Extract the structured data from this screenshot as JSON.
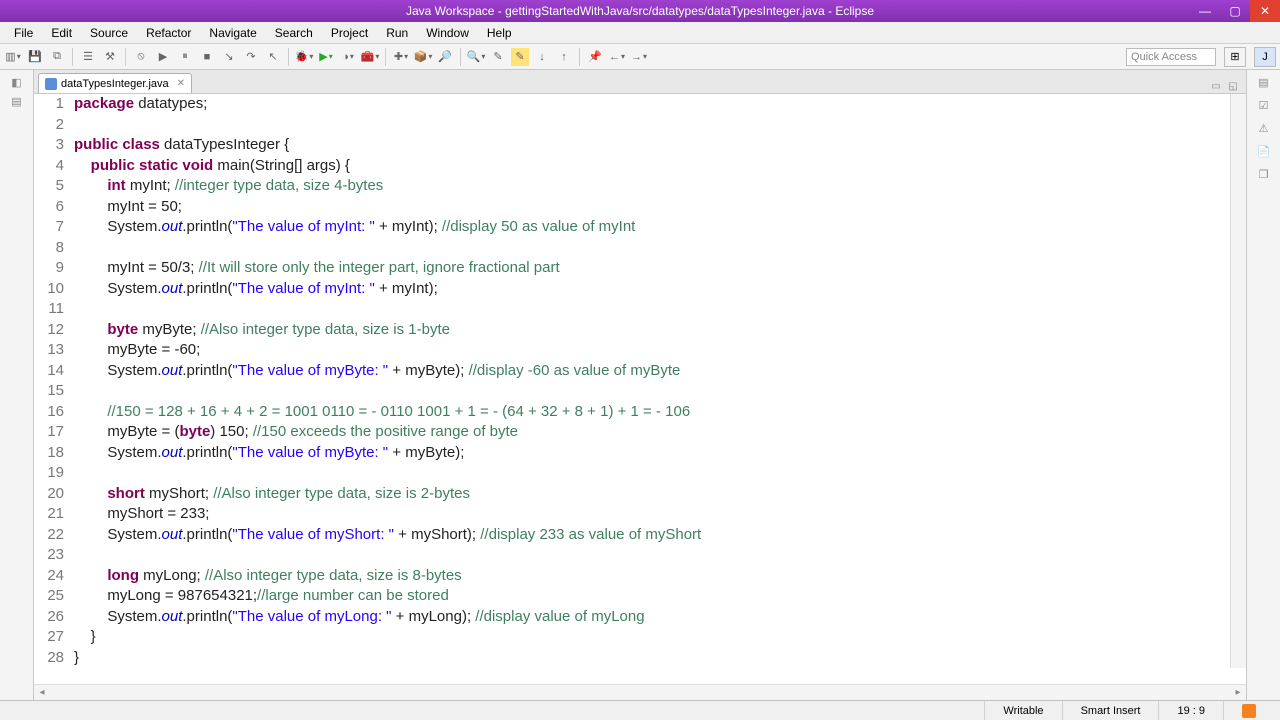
{
  "window": {
    "title": "Java Workspace - gettingStartedWithJava/src/datatypes/dataTypesInteger.java - Eclipse"
  },
  "menus": [
    "File",
    "Edit",
    "Source",
    "Refactor",
    "Navigate",
    "Search",
    "Project",
    "Run",
    "Window",
    "Help"
  ],
  "quick_access": "Quick Access",
  "tab": {
    "name": "dataTypesInteger.java"
  },
  "status": {
    "writable": "Writable",
    "insert": "Smart Insert",
    "position": "19 : 9"
  },
  "code": {
    "lines": [
      {
        "n": 1,
        "tokens": [
          {
            "t": "kw",
            "v": "package"
          },
          {
            "t": "p",
            "v": " datatypes;"
          }
        ]
      },
      {
        "n": 2,
        "tokens": []
      },
      {
        "n": 3,
        "tokens": [
          {
            "t": "kw",
            "v": "public"
          },
          {
            "t": "p",
            "v": " "
          },
          {
            "t": "kw",
            "v": "class"
          },
          {
            "t": "p",
            "v": " dataTypesInteger {"
          }
        ]
      },
      {
        "n": 4,
        "tokens": [
          {
            "t": "p",
            "v": "    "
          },
          {
            "t": "kw",
            "v": "public"
          },
          {
            "t": "p",
            "v": " "
          },
          {
            "t": "kw",
            "v": "static"
          },
          {
            "t": "p",
            "v": " "
          },
          {
            "t": "kw",
            "v": "void"
          },
          {
            "t": "p",
            "v": " main(String[] args) {"
          }
        ]
      },
      {
        "n": 5,
        "tokens": [
          {
            "t": "p",
            "v": "        "
          },
          {
            "t": "kw",
            "v": "int"
          },
          {
            "t": "p",
            "v": " myInt; "
          },
          {
            "t": "cmt",
            "v": "//integer type data, size 4-bytes"
          }
        ]
      },
      {
        "n": 6,
        "tokens": [
          {
            "t": "p",
            "v": "        myInt = 50;"
          }
        ]
      },
      {
        "n": 7,
        "tokens": [
          {
            "t": "p",
            "v": "        System."
          },
          {
            "t": "fld",
            "v": "out"
          },
          {
            "t": "p",
            "v": ".println("
          },
          {
            "t": "str",
            "v": "\"The value of myInt: \""
          },
          {
            "t": "p",
            "v": " + myInt); "
          },
          {
            "t": "cmt",
            "v": "//display 50 as value of myInt"
          }
        ]
      },
      {
        "n": 8,
        "tokens": []
      },
      {
        "n": 9,
        "tokens": [
          {
            "t": "p",
            "v": "        myInt = 50/3; "
          },
          {
            "t": "cmt",
            "v": "//It will store only the integer part, ignore fractional part"
          }
        ]
      },
      {
        "n": 10,
        "tokens": [
          {
            "t": "p",
            "v": "        System."
          },
          {
            "t": "fld",
            "v": "out"
          },
          {
            "t": "p",
            "v": ".println("
          },
          {
            "t": "str",
            "v": "\"The value of myInt: \""
          },
          {
            "t": "p",
            "v": " + myInt);"
          }
        ]
      },
      {
        "n": 11,
        "tokens": []
      },
      {
        "n": 12,
        "tokens": [
          {
            "t": "p",
            "v": "        "
          },
          {
            "t": "kw",
            "v": "byte"
          },
          {
            "t": "p",
            "v": " myByte; "
          },
          {
            "t": "cmt",
            "v": "//Also integer type data, size is 1-byte"
          }
        ]
      },
      {
        "n": 13,
        "tokens": [
          {
            "t": "p",
            "v": "        myByte = -60;"
          }
        ]
      },
      {
        "n": 14,
        "tokens": [
          {
            "t": "p",
            "v": "        System."
          },
          {
            "t": "fld",
            "v": "out"
          },
          {
            "t": "p",
            "v": ".println("
          },
          {
            "t": "str",
            "v": "\"The value of myByte: \""
          },
          {
            "t": "p",
            "v": " + myByte); "
          },
          {
            "t": "cmt",
            "v": "//display -60 as value of myByte"
          }
        ]
      },
      {
        "n": 15,
        "tokens": []
      },
      {
        "n": 16,
        "tokens": [
          {
            "t": "p",
            "v": "        "
          },
          {
            "t": "cmt",
            "v": "//150 = 128 + 16 + 4 + 2 = 1001 0110 = - 0110 1001 + 1 = - (64 + 32 + 8 + 1) + 1 = - 106"
          }
        ]
      },
      {
        "n": 17,
        "tokens": [
          {
            "t": "p",
            "v": "        myByte = ("
          },
          {
            "t": "kw",
            "v": "byte"
          },
          {
            "t": "p",
            "v": ") 150; "
          },
          {
            "t": "cmt",
            "v": "//150 exceeds the positive range of byte"
          }
        ]
      },
      {
        "n": 18,
        "tokens": [
          {
            "t": "p",
            "v": "        System."
          },
          {
            "t": "fld",
            "v": "out"
          },
          {
            "t": "p",
            "v": ".println("
          },
          {
            "t": "str",
            "v": "\"The value of myByte: \""
          },
          {
            "t": "p",
            "v": " + myByte);"
          }
        ]
      },
      {
        "n": 19,
        "tokens": [
          {
            "t": "p",
            "v": "        "
          }
        ],
        "highlight": true
      },
      {
        "n": 20,
        "tokens": [
          {
            "t": "p",
            "v": "        "
          },
          {
            "t": "kw",
            "v": "short"
          },
          {
            "t": "p",
            "v": " myShort; "
          },
          {
            "t": "cmt",
            "v": "//Also integer type data, size is 2-bytes"
          }
        ]
      },
      {
        "n": 21,
        "tokens": [
          {
            "t": "p",
            "v": "        myShort = 233;"
          }
        ]
      },
      {
        "n": 22,
        "tokens": [
          {
            "t": "p",
            "v": "        System."
          },
          {
            "t": "fld",
            "v": "out"
          },
          {
            "t": "p",
            "v": ".println("
          },
          {
            "t": "str",
            "v": "\"The value of myShort: \""
          },
          {
            "t": "p",
            "v": " + myShort); "
          },
          {
            "t": "cmt",
            "v": "//display 233 as value of myShort"
          }
        ]
      },
      {
        "n": 23,
        "tokens": []
      },
      {
        "n": 24,
        "tokens": [
          {
            "t": "p",
            "v": "        "
          },
          {
            "t": "kw",
            "v": "long"
          },
          {
            "t": "p",
            "v": " myLong; "
          },
          {
            "t": "cmt",
            "v": "//Also integer type data, size is 8-bytes"
          }
        ]
      },
      {
        "n": 25,
        "tokens": [
          {
            "t": "p",
            "v": "        myLong = 987654321;"
          },
          {
            "t": "cmt",
            "v": "//large number can be stored"
          }
        ]
      },
      {
        "n": 26,
        "tokens": [
          {
            "t": "p",
            "v": "        System."
          },
          {
            "t": "fld",
            "v": "out"
          },
          {
            "t": "p",
            "v": ".println("
          },
          {
            "t": "str",
            "v": "\"The value of myLong: \""
          },
          {
            "t": "p",
            "v": " + myLong); "
          },
          {
            "t": "cmt",
            "v": "//display value of myLong"
          }
        ]
      },
      {
        "n": 27,
        "tokens": [
          {
            "t": "p",
            "v": "    }"
          }
        ]
      },
      {
        "n": 28,
        "tokens": [
          {
            "t": "p",
            "v": "}"
          }
        ]
      }
    ]
  }
}
